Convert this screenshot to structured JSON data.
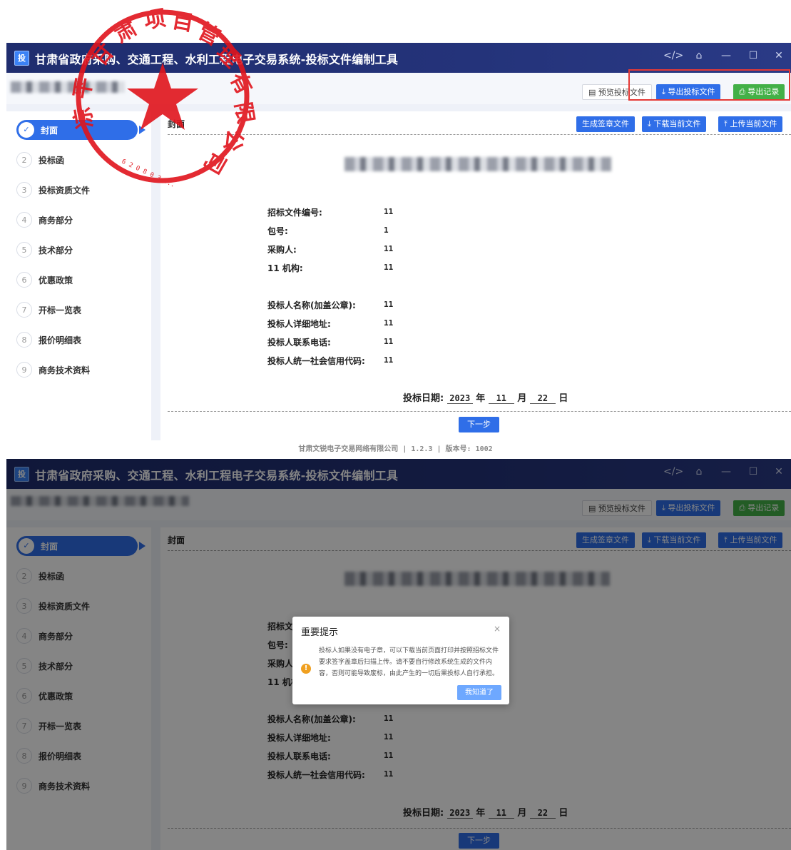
{
  "app": {
    "title": "甘肃省政府采购、交通工程、水利工程电子交易系统-投标文件编制工具",
    "logo_text": "投",
    "window_controls": [
      "</>",
      "⌂",
      "—",
      "☐",
      "✕"
    ]
  },
  "toolbar": {
    "preview_label": "预览投标文件",
    "export_label": "导出投标文件",
    "record_label": "导出记录"
  },
  "sidebar": {
    "items": [
      {
        "num": "✓",
        "label": "封面",
        "active": true
      },
      {
        "num": "2",
        "label": "投标函"
      },
      {
        "num": "3",
        "label": "投标资质文件"
      },
      {
        "num": "4",
        "label": "商务部分"
      },
      {
        "num": "5",
        "label": "技术部分"
      },
      {
        "num": "6",
        "label": "优惠政策"
      },
      {
        "num": "7",
        "label": "开标一览表"
      },
      {
        "num": "8",
        "label": "报价明细表"
      },
      {
        "num": "9",
        "label": "商务技术资料"
      }
    ]
  },
  "content": {
    "title": "封面",
    "sign_label": "生成签章文件",
    "download_label": "下载当前文件",
    "upload_label": "上传当前文件",
    "info": [
      {
        "label": "招标文件编号:",
        "value": "11"
      },
      {
        "label": "包号:",
        "value": "1"
      },
      {
        "label": "采购人:",
        "value": "11"
      },
      {
        "label": "11 机构:",
        "value": "11"
      },
      {
        "label": "投标人名称(加盖公章):",
        "value": "11"
      },
      {
        "label": "投标人详细地址:",
        "value": "11"
      },
      {
        "label": "投标人联系电话:",
        "value": "11"
      },
      {
        "label": "投标人统一社会信用代码:",
        "value": "11"
      }
    ],
    "date": {
      "label": "投标日期:",
      "year": "2023",
      "year_unit": "年",
      "month": "11",
      "month_unit": "月",
      "day": "22",
      "day_unit": "日"
    },
    "next_label": "下一步"
  },
  "footer": "甘肃文锐电子交易网络有限公司 | 1.2.3 | 版本号: 1002",
  "dialog": {
    "title": "重要提示",
    "close": "×",
    "message": "投标人如果没有电子章，可以下载当前页面打印并按照招标文件要求签字盖章后扫描上传。请不要自行修改系统生成的文件内容，否则可能导致废标，由此产生的一切后果投标人自行承担。",
    "ok_label": "我知道了"
  },
  "colors": {
    "titlebar": "#1f2d6e",
    "primary": "#2f6ee8",
    "success": "#43b047",
    "highlight": "#e53935",
    "stamp": "#e0141c"
  }
}
